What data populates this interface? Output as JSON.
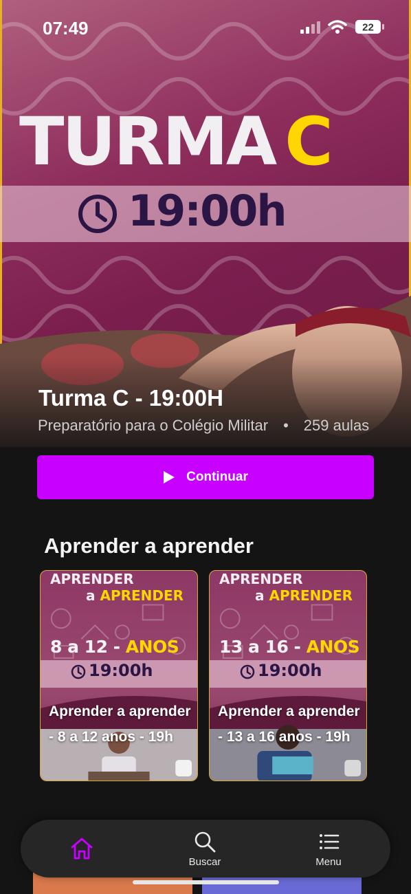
{
  "status_bar": {
    "time": "07:49",
    "battery_level": "22"
  },
  "hero": {
    "banner_title": "TURMA",
    "banner_title_accent": "C",
    "banner_time": "19:00h",
    "course_title": "Turma C - 19:00H",
    "course_subtitle": "Preparatório para o Colégio Militar",
    "separator": "•",
    "lesson_count": "259 aulas",
    "colors": {
      "accent_yellow": "#ffd600",
      "banner_purple": "#7a1e4e"
    }
  },
  "continue_button": {
    "label": "Continuar",
    "color": "#c800ff"
  },
  "section": {
    "title": "Aprender a aprender",
    "cards": [
      {
        "line1": "APRENDER",
        "line2_prefix": "a",
        "line2_accent": "APRENDER",
        "ages_prefix": "8 a 12 -",
        "ages_accent": "ANOS",
        "time": "19:00h",
        "caption": "Aprender a aprender - 8 a 12 anos - 19h"
      },
      {
        "line1": "APRENDER",
        "line2_prefix": "a",
        "line2_accent": "APRENDER",
        "ages_prefix": "13 a 16 -",
        "ages_accent": "ANOS",
        "time": "19:00h",
        "caption": "Aprender a aprender - 13 a 16 anos - 19h"
      }
    ]
  },
  "bottom_nav": {
    "items": [
      {
        "icon": "home-icon",
        "label": "",
        "active": true
      },
      {
        "icon": "search-icon",
        "label": "Buscar"
      },
      {
        "icon": "menu-icon",
        "label": "Menu"
      }
    ],
    "active_color": "#c800ff"
  }
}
